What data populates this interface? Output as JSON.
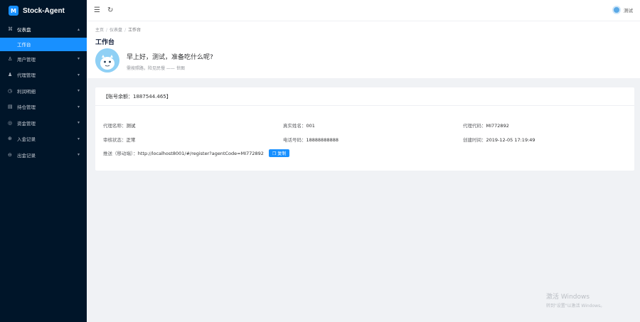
{
  "app": {
    "title": "Stock-Agent",
    "logo_letter": "M"
  },
  "sidebar": {
    "items": [
      {
        "icon": "dashboard-icon",
        "glyph": "⌘",
        "label": "仪表盘",
        "open": true,
        "children": [
          {
            "label": "工作台",
            "active": true
          }
        ]
      },
      {
        "icon": "user-icon",
        "glyph": "♙",
        "label": "用户管理"
      },
      {
        "icon": "agent-icon",
        "glyph": "♟",
        "label": "代理管理"
      },
      {
        "icon": "clock-icon",
        "glyph": "◷",
        "label": "利润明细"
      },
      {
        "icon": "position-icon",
        "glyph": "▤",
        "label": "持仓管理"
      },
      {
        "icon": "money-icon",
        "glyph": "◎",
        "label": "资金管理"
      },
      {
        "icon": "deposit-icon",
        "glyph": "⊕",
        "label": "入金记录"
      },
      {
        "icon": "withdraw-icon",
        "glyph": "⊖",
        "label": "出金记录"
      }
    ]
  },
  "header": {
    "user_name": "测试"
  },
  "breadcrumb": [
    "主页",
    "仪表盘",
    "工作台"
  ],
  "page": {
    "title": "工作台",
    "greeting": "早上好，测试，准备吃什么呢?",
    "motto": "需按照路，险见民慢 —— 世图"
  },
  "card": {
    "balance_text": "【账号余额：1887544.465】",
    "fields": {
      "agent_name_label": "代理名称：",
      "agent_name": "测试",
      "real_name_label": "真实姓名：",
      "real_name": "001",
      "agent_code_label": "代理代码：",
      "agent_code": "MI772892",
      "status_label": "审核状态：",
      "status": "正常",
      "phone_label": "电话号码：",
      "phone": "18888888888",
      "created_label": "创建时间：",
      "created": "2019-12-05 17:19:49",
      "promo_label": "推送（移动端）：",
      "promo_url": "http://localhost8001/#/register?agentCode=MI772892",
      "copy_label": "复制"
    }
  },
  "watermark": {
    "line1": "激活 Windows",
    "line2": "转到\"设置\"以激活 Windows。"
  },
  "colors": {
    "sidebar_bg": "#001529",
    "accent": "#1890ff",
    "content_bg": "#f0f2f5"
  }
}
